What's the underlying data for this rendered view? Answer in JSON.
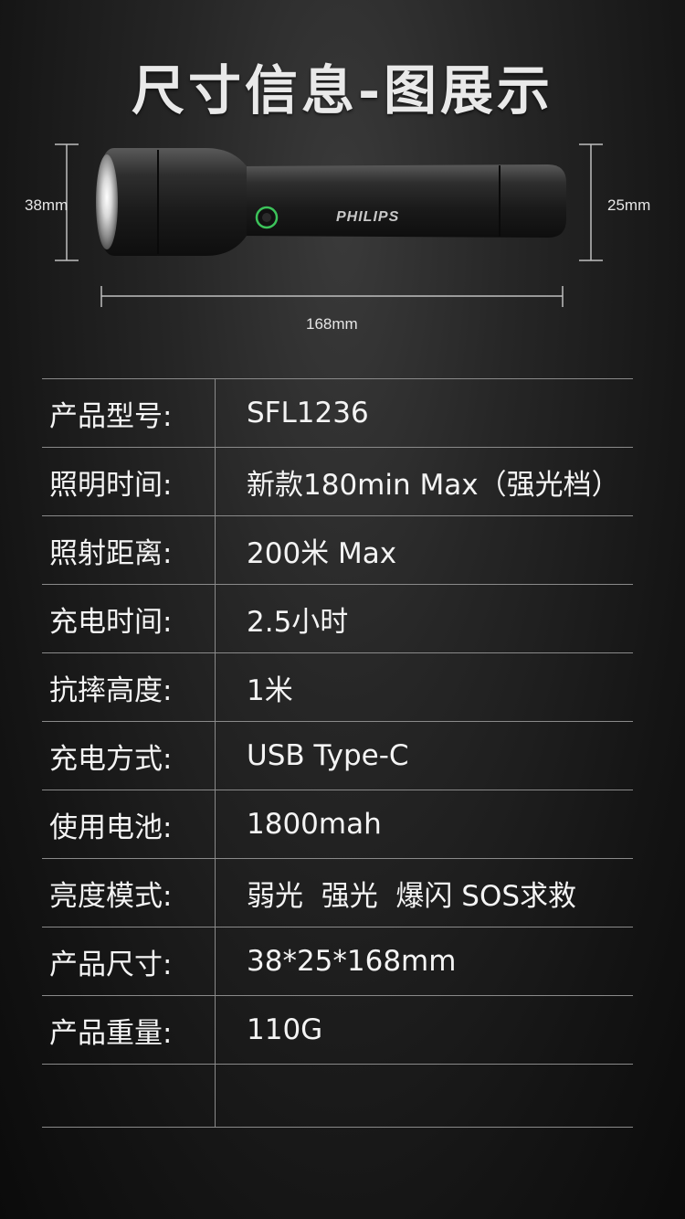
{
  "title": "尺寸信息-图展示",
  "dimensions": {
    "head_diameter": "38mm",
    "tail_diameter": "25mm",
    "length": "168mm"
  },
  "product": {
    "brand_label": "PHILIPS"
  },
  "colors": {
    "background": "#1a1a1a",
    "text": "#f2f2f2",
    "grid_line": "#8a8a8a",
    "switch_ring": "#3cc35a"
  },
  "specs": [
    {
      "label": "产品型号:",
      "value": "SFL1236"
    },
    {
      "label": "照明时间:",
      "value": "新款180min Max（强光档）"
    },
    {
      "label": "照射距离:",
      "value": "200米 Max"
    },
    {
      "label": "充电时间:",
      "value": "2.5小时"
    },
    {
      "label": "抗摔高度:",
      "value": "1米"
    },
    {
      "label": "充电方式:",
      "value": "USB Type-C"
    },
    {
      "label": "使用电池:",
      "value": "1800mah"
    },
    {
      "label": "亮度模式:",
      "value": "弱光  强光  爆闪 SOS求救"
    },
    {
      "label": "产品尺寸:",
      "value": "38*25*168mm"
    },
    {
      "label": "产品重量:",
      "value": "110G"
    },
    {
      "label": "",
      "value": ""
    }
  ]
}
